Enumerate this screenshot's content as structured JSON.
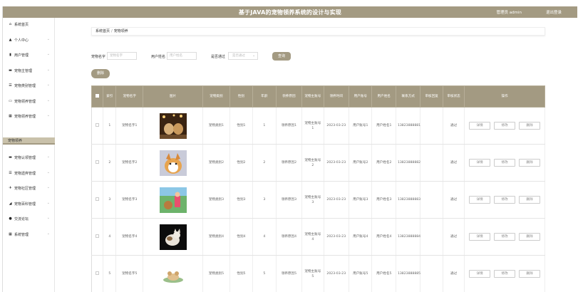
{
  "header": {
    "title": "基于JAVA的宠物领养系统的设计与实现",
    "user": "管理员 admin",
    "logout": "退出登录"
  },
  "sidebar": {
    "items": [
      {
        "label": "系统首页",
        "icon": "home-icon",
        "glyph": "⌂"
      },
      {
        "label": "个人中心",
        "icon": "user-icon",
        "glyph": "▲"
      },
      {
        "label": "用户管理",
        "icon": "chart-icon",
        "glyph": "▮"
      },
      {
        "label": "宠物主管理",
        "icon": "folder-icon",
        "glyph": "▬"
      },
      {
        "label": "宠物类别管理",
        "icon": "sliders-icon",
        "glyph": "☰"
      },
      {
        "label": "宠物领养管理",
        "icon": "monitor-icon",
        "glyph": "▭"
      },
      {
        "label": "宠物领养管理",
        "icon": "grid-icon",
        "glyph": "▦"
      },
      {
        "label": "宠物认领管理",
        "icon": "book-icon",
        "glyph": "▬"
      },
      {
        "label": "宠物遗弃管理",
        "icon": "list-icon",
        "glyph": "☰"
      },
      {
        "label": "宠物社区管理",
        "icon": "pin-icon",
        "glyph": "✈"
      },
      {
        "label": "宠物百科管理",
        "icon": "graph-icon",
        "glyph": "◢"
      },
      {
        "label": "交流论坛",
        "icon": "location-icon",
        "glyph": "●"
      },
      {
        "label": "系统管理",
        "icon": "grid-icon",
        "glyph": "▦"
      }
    ],
    "active_sub": "宠物领养"
  },
  "breadcrumb": {
    "home": "系统首页",
    "separator": "/",
    "current": "宠物领养"
  },
  "filters": {
    "pet_name_label": "宠物名字",
    "pet_name_placeholder": "宠物名字",
    "username_label": "用户姓名",
    "username_placeholder": "用户姓名",
    "approved_label": "是否通过",
    "approved_placeholder": "是否通过",
    "search_button": "查询"
  },
  "delete_button": "删除",
  "table": {
    "headers": [
      "索引",
      "宠物名字",
      "图片",
      "宠物类别",
      "性别",
      "年龄",
      "领养原因",
      "宠物主账号",
      "领养时间",
      "用户账号",
      "用户姓名",
      "联系方式",
      "审核回复",
      "审核状态",
      "操作"
    ],
    "rows": [
      {
        "index": "1",
        "name": "宠物名字1",
        "category": "宠物类别1",
        "gender": "性别1",
        "age": "1",
        "reason": "领养原因1",
        "owner": "宠物主账号1",
        "time": "2023-03-23",
        "account": "用户账号1",
        "username": "用户姓名1",
        "phone": "13823888881",
        "reply": "",
        "status": "通过",
        "image": "dogs-icon"
      },
      {
        "index": "2",
        "name": "宠物名字2",
        "category": "宠物类别2",
        "gender": "性别2",
        "age": "2",
        "reason": "领养原因2",
        "owner": "宠物主账号2",
        "time": "2023-03-23",
        "account": "用户账号2",
        "username": "用户姓名2",
        "phone": "13823888882",
        "reply": "",
        "status": "通过",
        "image": "dog-icon"
      },
      {
        "index": "3",
        "name": "宠物名字3",
        "category": "宠物类别3",
        "gender": "性别3",
        "age": "3",
        "reason": "领养原因3",
        "owner": "宠物主账号3",
        "time": "2023-03-23",
        "account": "用户账号3",
        "username": "用户姓名3",
        "phone": "13823888883",
        "reply": "",
        "status": "通过",
        "image": "girl-dog-icon"
      },
      {
        "index": "4",
        "name": "宠物名字4",
        "category": "宠物类别4",
        "gender": "性别4",
        "age": "4",
        "reason": "领养原因4",
        "owner": "宠物主账号4",
        "time": "2023-03-23",
        "account": "用户账号4",
        "username": "用户姓名4",
        "phone": "13823888884",
        "reply": "",
        "status": "通过",
        "image": "cat-icon"
      },
      {
        "index": "5",
        "name": "宠物名字5",
        "category": "宠物类别5",
        "gender": "性别5",
        "age": "5",
        "reason": "领养原因5",
        "owner": "宠物主账号5",
        "time": "2023-03-23",
        "account": "用户账号5",
        "username": "用户姓名5",
        "phone": "13823888885",
        "reply": "",
        "status": "通过",
        "image": "puppy-icon"
      }
    ],
    "ops": {
      "detail": "详情",
      "edit": "修改",
      "delete": "删除"
    }
  },
  "colors": {
    "accent": "#a39a82",
    "accent_light": "#c9c1aa"
  }
}
